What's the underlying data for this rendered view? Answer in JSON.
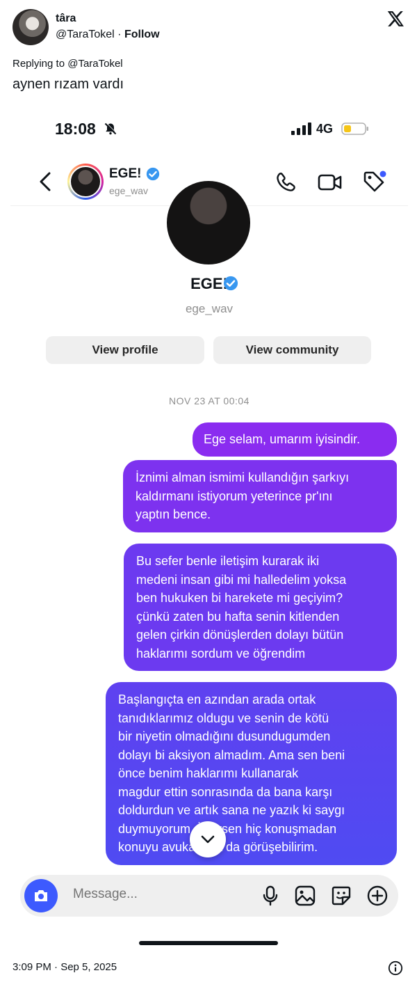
{
  "tweet": {
    "display_name": "târa",
    "handle": "@TaraTokel",
    "separator": "·",
    "follow_label": "Follow",
    "replying_to": "Replying to @TaraTokel",
    "text": "aynen rızam vardı",
    "timestamp": "3:09 PM · Sep 5, 2025",
    "brand_icon": "x-logo-icon"
  },
  "phone": {
    "status": {
      "time": "18:08",
      "network": "4G"
    },
    "header": {
      "name": "EGE!",
      "handle": "ege_wav"
    },
    "profile": {
      "name": "EGE!",
      "handle": "ege_wav",
      "view_profile": "View profile",
      "view_community": "View community"
    },
    "date_separator": "NOV 23 AT 00:04",
    "messages": [
      {
        "lines": [
          "Ege selam, umarım iyisindir."
        ]
      },
      {
        "lines": [
          "İznimi alman ismimi kullandığın şarkıyı",
          "kaldırmanı istiyorum yeterince pr'ını",
          "yaptın bence."
        ]
      },
      {
        "lines": [
          "Bu sefer benle iletişim kurarak iki",
          "medeni insan gibi mi halledelim yoksa",
          "ben hukuken bi harekete mi geçiyim?",
          "çünkü zaten bu hafta senin kitlenden",
          "gelen çirkin dönüşlerden dolayı bütün",
          "haklarımı sordum ve öğrendim"
        ]
      },
      {
        "lines": [
          "Başlangıçta en azından arada ortak",
          "tanıdıklarımız oldugu ve senin de kötü",
          "bir niyetin olmadığını dusundugumden",
          "dolayı bi aksiyon almadım. Ama sen beni",
          "önce benim haklarımı kullanarak",
          "magdur ettin sonrasında da bana karşı",
          "doldurdun ve artık sana ne yazık ki saygı",
          "duymuyorum. İstersen hiç konuşmadan",
          "konuyu avukatlarla da görüşebilirim."
        ]
      }
    ],
    "composer": {
      "placeholder": "Message..."
    }
  },
  "colors": {
    "bubble_1": "#8a2cf0",
    "bubble_4": "#4f4bf2",
    "camera_button": "#3d5afe",
    "verified": "#3897f0"
  }
}
